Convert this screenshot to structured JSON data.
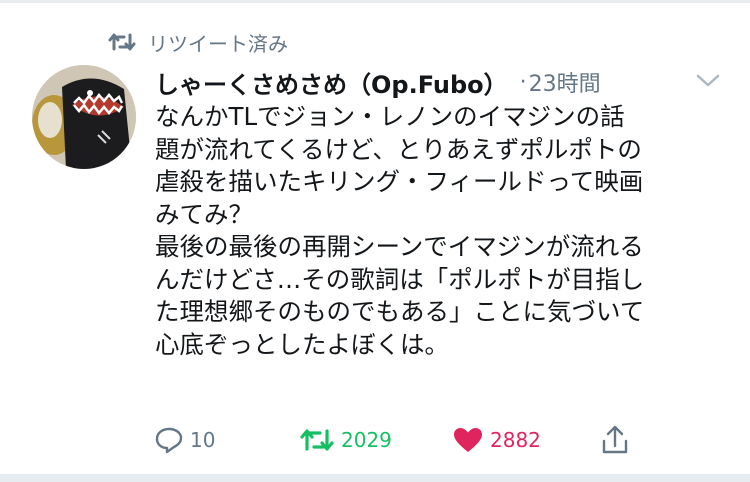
{
  "retweet_context": {
    "label": "リツイート済み"
  },
  "tweet": {
    "display_name": "しゃーくさめさめ（Op.Fubo）",
    "separator": "·",
    "time": "23時間",
    "lines": [
      "なんかTLでジョン・レノンのイマジンの話",
      "題が流れてくるけど、とりあえずポルポトの",
      "虐殺を描いたキリング・フィールドって映画",
      "みてみ？",
      "最後の最後の再開シーンでイマジンが流れる",
      "んだけどさ…その歌詞は「ポルポトが目指し",
      "た理想郷そのものでもある」ことに気づいて",
      "心底ぞっとしたよぼくは。"
    ]
  },
  "actions": {
    "reply_count": "10",
    "retweet_count": "2029",
    "like_count": "2882"
  },
  "colors": {
    "text": "#14171a",
    "secondary": "#657786",
    "retweet": "#17bf63",
    "like": "#e0245e"
  }
}
